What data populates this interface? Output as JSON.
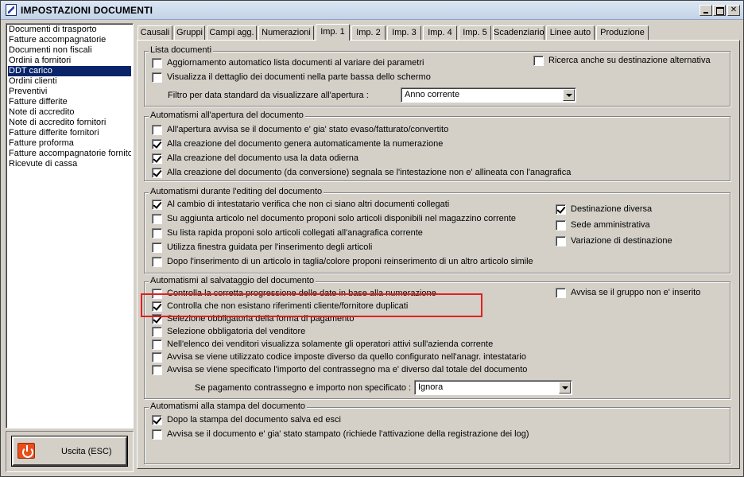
{
  "window": {
    "title": "IMPOSTAZIONI DOCUMENTI"
  },
  "doc_list": [
    "Documenti di trasporto",
    "Fatture accompagnatorie",
    "Documenti non fiscali",
    "Ordini a fornitori",
    "DDT carico",
    "Ordini clienti",
    "Preventivi",
    "Fatture differite",
    "Note di accredito",
    "Note di accredito fornitori",
    "Fatture differite fornitori",
    "Fatture proforma",
    "Fatture accompagnatorie fornito",
    "Ricevute di cassa"
  ],
  "selected_doc": "DDT carico",
  "exit_button": {
    "label": "Uscita (ESC)"
  },
  "tabs": [
    "Causali",
    "Gruppi",
    "Campi agg.",
    "Numerazioni",
    "Imp. 1",
    "Imp. 2",
    "Imp. 3",
    "Imp. 4",
    "Imp. 5",
    "Scadenziario",
    "Linee auto",
    "Produzione"
  ],
  "active_tab": "Imp. 1",
  "groups": {
    "lista": {
      "title": "Lista documenti",
      "items": [
        {
          "label": "Aggiornamento automatico lista documenti al variare dei parametri",
          "checked": false
        },
        {
          "label": "Visualizza il dettaglio dei documenti nella parte bassa dello schermo",
          "checked": false
        }
      ],
      "right_items": [
        {
          "label": "Ricerca anche su destinazione alternativa",
          "checked": false
        }
      ],
      "filter_label": "Filtro per data standard da visualizzare all'apertura :",
      "filter_value": "Anno corrente"
    },
    "apertura": {
      "title": "Automatismi all'apertura del documento",
      "items": [
        {
          "label": "All'apertura avvisa se il documento e' gia' stato evaso/fatturato/convertito",
          "checked": false
        },
        {
          "label": "Alla creazione del documento genera automaticamente la numerazione",
          "checked": true
        },
        {
          "label": "Alla creazione del documento usa la data odierna",
          "checked": true
        },
        {
          "label": "Alla creazione del documento (da conversione) segnala se l'intestazione non e' allineata con l'anagrafica",
          "checked": true
        }
      ]
    },
    "editing": {
      "title": "Automatismi durante l'editing del documento",
      "items": [
        {
          "label": "Al cambio di intestatario verifica che non ci siano altri documenti collegati",
          "checked": true
        },
        {
          "label": "Su aggiunta articolo nel documento proponi solo articoli disponibili nel magazzino corrente",
          "checked": false
        },
        {
          "label": "Su lista rapida proponi solo articoli collegati all'anagrafica corrente",
          "checked": false
        },
        {
          "label": "Utilizza finestra guidata per l'inserimento degli articoli",
          "checked": false
        },
        {
          "label": "Dopo l'inserimento di un articolo in taglia/colore proponi reinserimento di un altro articolo simile",
          "checked": false
        }
      ],
      "right_items": [
        {
          "label": "Destinazione diversa",
          "checked": true
        },
        {
          "label": "Sede amministrativa",
          "checked": false
        },
        {
          "label": "Variazione di destinazione",
          "checked": false
        }
      ]
    },
    "salvataggio": {
      "title": "Automatismi al salvataggio del documento",
      "items": [
        {
          "label": "Controlla la corretta progressione delle date in base alla numerazione",
          "checked": false
        },
        {
          "label": "Controlla che non esistano riferimenti cliente/fornitore duplicati",
          "checked": true
        },
        {
          "label": "Selezione obbligatoria della forma di pagamento",
          "checked": true
        },
        {
          "label": "Selezione obbligatoria del venditore",
          "checked": false
        },
        {
          "label": "Nell'elenco dei venditori visualizza solamente gli operatori attivi sull'azienda corrente",
          "checked": false
        },
        {
          "label": "Avvisa se viene utilizzato codice imposte diverso da quello configurato nell'anagr. intestatario",
          "checked": false
        },
        {
          "label": "Avvisa se viene specificato l'importo del contrassegno ma e' diverso dal totale del documento",
          "checked": false
        }
      ],
      "right_items": [
        {
          "label": "Avvisa se il gruppo non e' inserito",
          "checked": false
        }
      ],
      "payment_label": "Se pagamento contrassegno e importo non specificato :",
      "payment_value": "Ignora"
    },
    "stampa": {
      "title": "Automatismi alla stampa del documento",
      "items": [
        {
          "label": "Dopo la stampa del documento salva ed esci",
          "checked": true
        },
        {
          "label": "Avvisa se il documento e' gia' stato stampato (richiede l'attivazione della registrazione dei log)",
          "checked": false
        }
      ]
    }
  }
}
